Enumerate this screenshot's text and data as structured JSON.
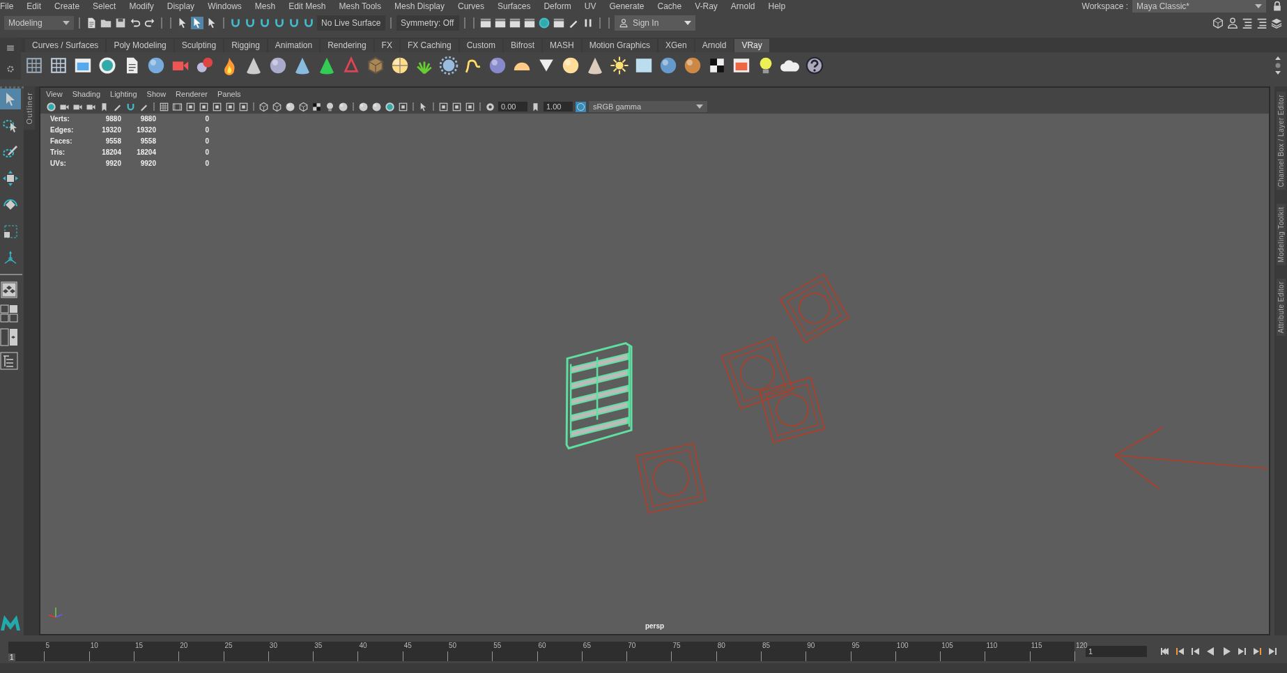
{
  "menu_bar": {
    "items": [
      "File",
      "Edit",
      "Create",
      "Select",
      "Modify",
      "Display",
      "Windows",
      "Mesh",
      "Edit Mesh",
      "Mesh Tools",
      "Mesh Display",
      "Curves",
      "Surfaces",
      "Deform",
      "UV",
      "Generate",
      "Cache",
      "V-Ray",
      "Arnold",
      "Help"
    ],
    "workspace_label": "Workspace :",
    "workspace": "Maya Classic*"
  },
  "status_line": {
    "mode": "Modeling",
    "live_surface": "No Live Surface",
    "symmetry": "Symmetry: Off",
    "sign_in": "Sign In"
  },
  "shelf_tabs": [
    {
      "label": "Curves / Surfaces",
      "selected": false
    },
    {
      "label": "Poly Modeling",
      "selected": false
    },
    {
      "label": "Sculpting",
      "selected": false
    },
    {
      "label": "Rigging",
      "selected": false
    },
    {
      "label": "Animation",
      "selected": false
    },
    {
      "label": "Rendering",
      "selected": false
    },
    {
      "label": "FX",
      "selected": false
    },
    {
      "label": "FX Caching",
      "selected": false
    },
    {
      "label": "Custom",
      "selected": false
    },
    {
      "label": "Bifrost",
      "selected": false
    },
    {
      "label": "MASH",
      "selected": false
    },
    {
      "label": "Motion Graphics",
      "selected": false
    },
    {
      "label": "XGen",
      "selected": false
    },
    {
      "label": "Arnold",
      "selected": false
    },
    {
      "label": "VRay",
      "selected": true
    }
  ],
  "tools": [
    {
      "kind": "select",
      "selected": true
    },
    {
      "kind": "lasso",
      "selected": false
    },
    {
      "kind": "paint",
      "selected": false
    },
    {
      "kind": "move",
      "selected": false
    },
    {
      "kind": "rotate",
      "selected": false
    },
    {
      "kind": "scale",
      "selected": false
    },
    {
      "kind": "manipulator",
      "selected": false
    }
  ],
  "outliner_tab": "Outliner",
  "panel": {
    "menus": [
      "View",
      "Shading",
      "Lighting",
      "Show",
      "Renderer",
      "Panels"
    ],
    "exposure": "0.00",
    "gamma": "1.00",
    "color_space": "sRGB gamma",
    "stats": [
      {
        "label": "Verts:",
        "values": [
          "9880",
          "9880",
          "0"
        ]
      },
      {
        "label": "Edges:",
        "values": [
          "19320",
          "19320",
          "0"
        ]
      },
      {
        "label": "Faces:",
        "values": [
          "9558",
          "9558",
          "0"
        ]
      },
      {
        "label": "Tris:",
        "values": [
          "18204",
          "18204",
          "0"
        ]
      },
      {
        "label": "UVs:",
        "values": [
          "9920",
          "9920",
          "0"
        ]
      }
    ],
    "camera": "persp"
  },
  "side_tabs": [
    "Channel Box / Layer Editor",
    "Modeling Toolkit",
    "Attribute Editor"
  ],
  "timeline": {
    "labels": [
      "5",
      "10",
      "15",
      "20",
      "25",
      "30",
      "35",
      "40",
      "45",
      "50",
      "55",
      "60",
      "65",
      "70",
      "75",
      "80",
      "85",
      "90",
      "95",
      "100",
      "105",
      "110",
      "115",
      "120"
    ],
    "start_frame": "1",
    "current_frame": "1",
    "level": 0
  }
}
